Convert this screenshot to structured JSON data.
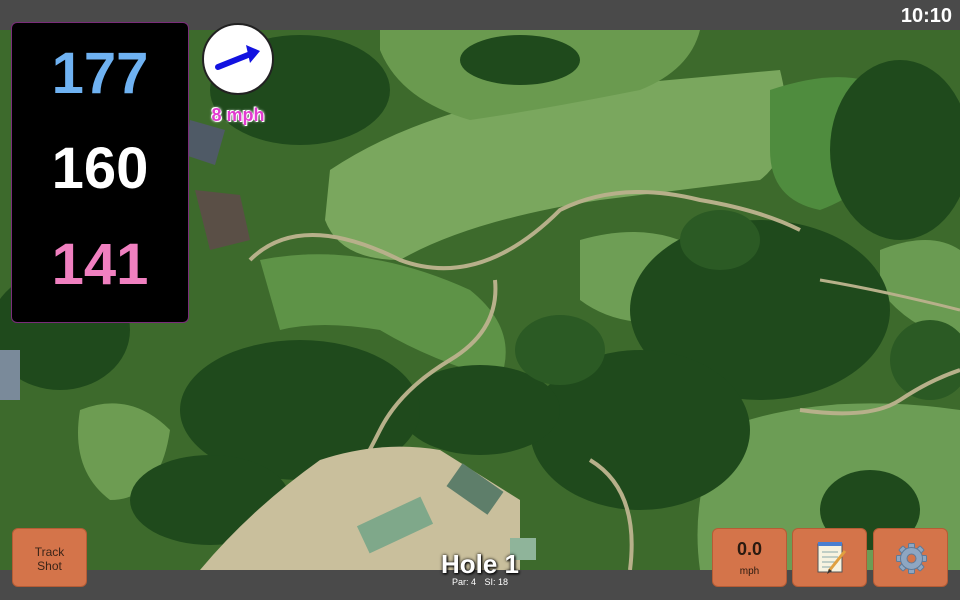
{
  "status_bar": {
    "time": "10:10"
  },
  "distances": {
    "back": "177",
    "middle": "160",
    "front": "141",
    "colors": {
      "back": "#6fb2f2",
      "middle": "#ffffff",
      "front": "#f080c0"
    }
  },
  "wind": {
    "direction_icon": "wind-direction-arrow-icon",
    "speed_label": "8 mph"
  },
  "hole": {
    "title": "Hole 1",
    "par_label": "Par: 4",
    "si_label": "SI: 18"
  },
  "buttons": {
    "track_shot": "Track\nShot",
    "wind_value": "0.0",
    "wind_unit": "mph",
    "notes_icon": "notepad-icon",
    "settings_icon": "gear-icon",
    "accent": "#d4744a"
  }
}
